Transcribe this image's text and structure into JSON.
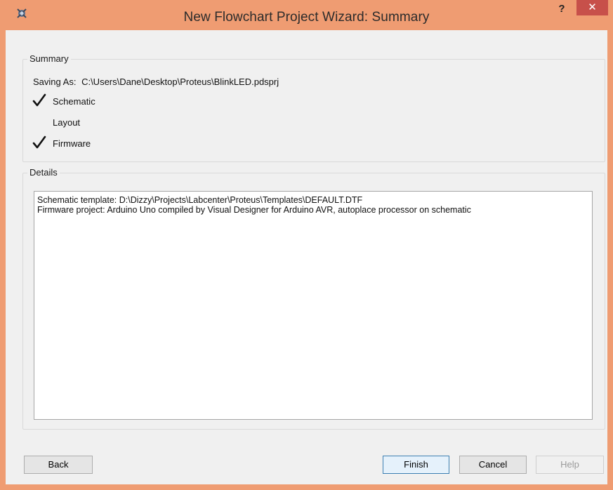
{
  "window": {
    "title": "New Flowchart Project Wizard: Summary",
    "help_label": "?",
    "close_label": "✕"
  },
  "summary": {
    "legend": "Summary",
    "saving_as_label": "Saving As:",
    "saving_as_path": "C:\\Users\\Dane\\Desktop\\Proteus\\BlinkLED.pdsprj",
    "items": [
      {
        "label": "Schematic",
        "checked": true
      },
      {
        "label": "Layout",
        "checked": false
      },
      {
        "label": "Firmware",
        "checked": true
      }
    ]
  },
  "details": {
    "legend": "Details",
    "lines": [
      "Schematic template: D:\\Dizzy\\Projects\\Labcenter\\Proteus\\Templates\\DEFAULT.DTF",
      "Firmware project: Arduino Uno compiled by Visual Designer for Arduino AVR, autoplace processor on schematic"
    ]
  },
  "buttons": {
    "back": "Back",
    "finish": "Finish",
    "cancel": "Cancel",
    "help": "Help"
  },
  "colors": {
    "titlebar": "#ef9c72",
    "close": "#c7504a",
    "client": "#f0f0f0"
  }
}
